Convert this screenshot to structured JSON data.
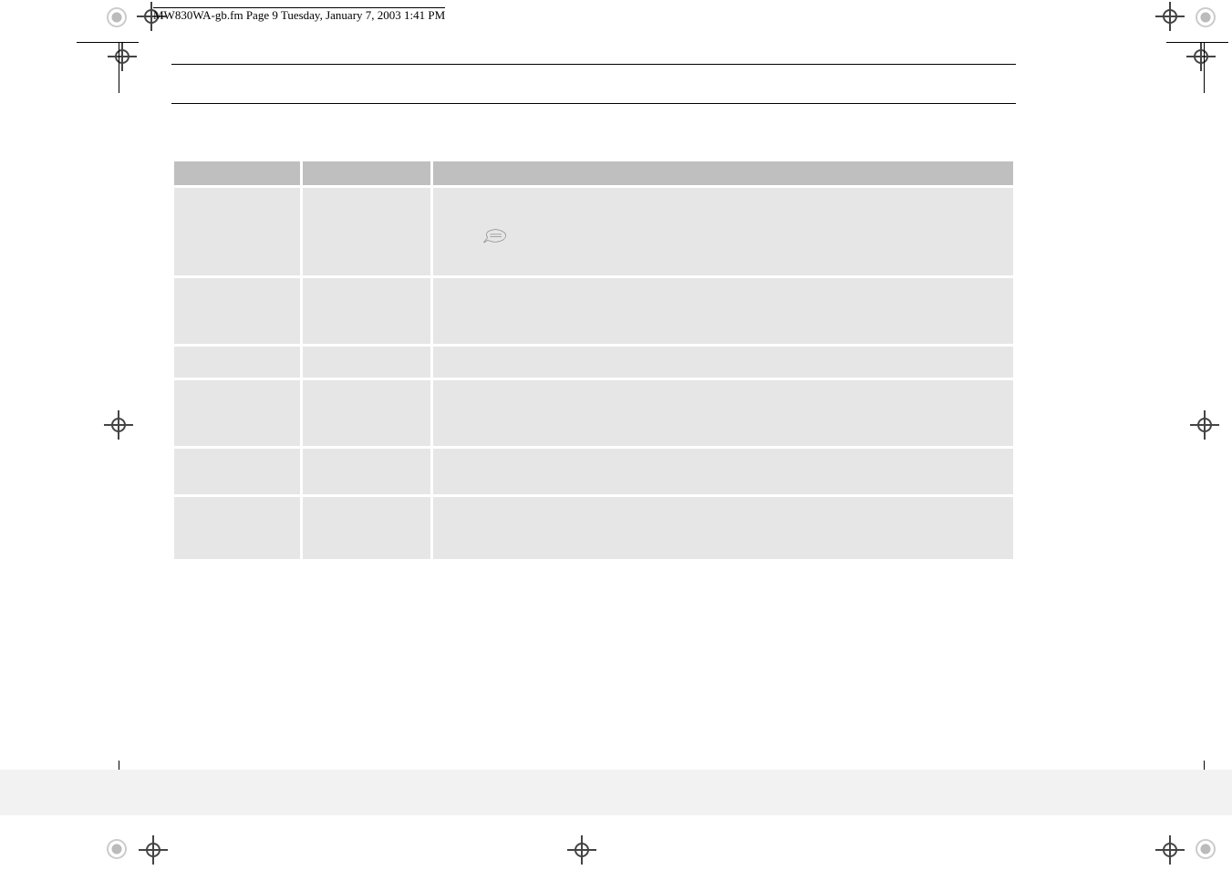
{
  "header": {
    "file_line": "MW830WA-gb.fm  Page 9  Tuesday, January 7, 2003  1:41 PM"
  },
  "table": {
    "columns": [
      "",
      "",
      ""
    ],
    "rows": [
      {
        "c1": "",
        "c2": "",
        "c3": ""
      },
      {
        "c1": "",
        "c2": "",
        "c3": ""
      },
      {
        "c1": "",
        "c2": "",
        "c3": ""
      },
      {
        "c1": "",
        "c2": "",
        "c3": ""
      },
      {
        "c1": "",
        "c2": "",
        "c3": ""
      },
      {
        "c1": "",
        "c2": "",
        "c3": ""
      }
    ],
    "note_icon_name": "note-icon"
  }
}
